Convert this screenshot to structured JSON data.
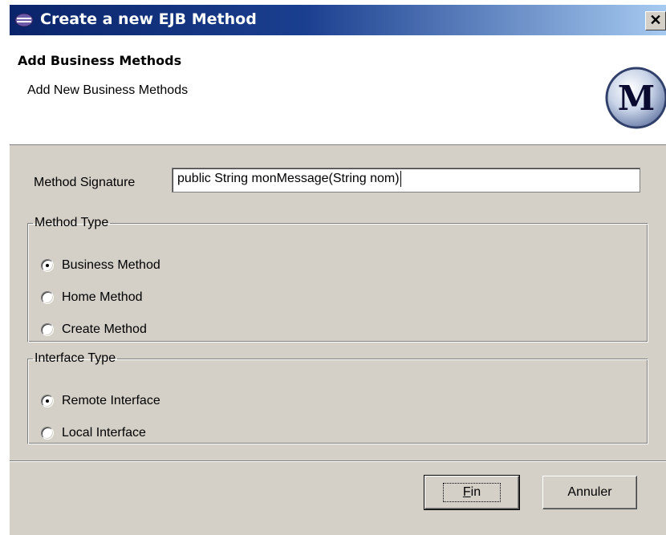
{
  "window": {
    "title": "Create a new EJB Method",
    "close_symbol": "✕"
  },
  "header": {
    "title": "Add Business Methods",
    "subtitle": "Add New Business Methods",
    "logo_letter": "M"
  },
  "form": {
    "signature_label": "Method Signature",
    "signature_value": "public String monMessage(String nom)"
  },
  "method_type": {
    "legend": "Method Type",
    "options": [
      {
        "label": "Business Method",
        "checked": true
      },
      {
        "label": "Home Method",
        "checked": false
      },
      {
        "label": "Create Method",
        "checked": false
      }
    ]
  },
  "interface_type": {
    "legend": "Interface Type",
    "options": [
      {
        "label": "Remote Interface",
        "checked": true
      },
      {
        "label": "Local Interface",
        "checked": false
      }
    ]
  },
  "buttons": {
    "finish": "Fin",
    "cancel": "Annuler"
  },
  "colors": {
    "titlebar_start": "#0a246a",
    "titlebar_end": "#a6caf0",
    "dialog_face": "#d4d0c8"
  }
}
